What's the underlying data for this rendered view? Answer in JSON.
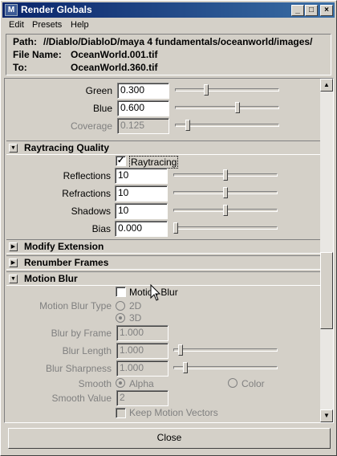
{
  "window": {
    "title": "Render Globals"
  },
  "menu": [
    "Edit",
    "Presets",
    "Help"
  ],
  "path": {
    "path_label": "Path:",
    "path_value": "//Diablo/DiabloD/maya 4 fundamentals/oceanworld/images/",
    "file_label": "File Name:",
    "file_value": "OceanWorld.001.tif",
    "to_label": "To:",
    "to_value": "OceanWorld.360.tif"
  },
  "color": {
    "green_label": "Green",
    "green_value": "0.300",
    "green_level": 0.3,
    "blue_label": "Blue",
    "blue_value": "0.600",
    "blue_level": 0.6,
    "coverage_label": "Coverage",
    "coverage_value": "0.125",
    "coverage_level": 0.125
  },
  "raytracing": {
    "title": "Raytracing Quality",
    "checkbox_label": "Raytracing",
    "checked": true,
    "reflections_label": "Reflections",
    "reflections_value": "10",
    "refractions_label": "Refractions",
    "refractions_value": "10",
    "shadows_label": "Shadows",
    "shadows_value": "10",
    "bias_label": "Bias",
    "bias_value": "0.000"
  },
  "sections": {
    "modify_extension": "Modify Extension",
    "renumber_frames": "Renumber Frames",
    "motion_blur": "Motion Blur"
  },
  "motion_blur": {
    "checkbox_label": "Motion Blur",
    "checked": false,
    "type_label": "Motion Blur Type",
    "type_2d": "2D",
    "type_3d": "3D",
    "blur_by_frame_label": "Blur by Frame",
    "blur_by_frame_value": "1.000",
    "blur_length_label": "Blur Length",
    "blur_length_value": "1.000",
    "blur_sharpness_label": "Blur Sharpness",
    "blur_sharpness_value": "1.000",
    "smooth_label": "Smooth",
    "smooth_alpha": "Alpha",
    "smooth_color": "Color",
    "smooth_value_label": "Smooth Value",
    "smooth_value": "2",
    "keep_vectors_label": "Keep Motion Vectors"
  },
  "buttons": {
    "close": "Close"
  }
}
